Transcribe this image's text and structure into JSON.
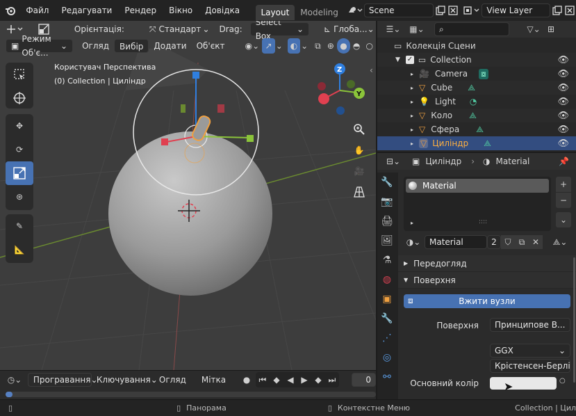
{
  "menu": {
    "items": [
      "Файл",
      "Редагувати",
      "Рендер",
      "Вікно",
      "Довідка"
    ],
    "tabs": [
      "Layout",
      "Modeling"
    ],
    "scene": "Scene",
    "view_layer": "View Layer"
  },
  "viewport_header": {
    "orientation_label": "Орієнтація:",
    "orientation_value": "Стандарт",
    "drag_label": "Drag:",
    "drag_value": "Select Box",
    "transform_value": "Глоба...",
    "mode": "Режим Об'є...",
    "view": "Огляд",
    "select": "Вибір",
    "add": "Додати",
    "object": "Об'єкт"
  },
  "viewport": {
    "view_name": "Користувач Перспектива",
    "collection_info": "(0) Collection | Циліндр",
    "gizmo_axes": [
      "X",
      "Y",
      "Z"
    ]
  },
  "timeline": {
    "playback": "Програвання",
    "keying": "Ключування",
    "view": "Огляд",
    "marker": "Мітка",
    "frame": "0"
  },
  "statusbar": {
    "pan": "Панорама",
    "context_menu": "Контекстне Меню",
    "info": "Collection | Цил"
  },
  "outliner": {
    "scene_collection": "Колекція Сцени",
    "collection": "Collection",
    "items": [
      {
        "name": "Camera",
        "kind": "camera",
        "selected": false
      },
      {
        "name": "Cube",
        "kind": "mesh",
        "selected": false
      },
      {
        "name": "Light",
        "kind": "light",
        "selected": false
      },
      {
        "name": "Коло",
        "kind": "mesh",
        "selected": false
      },
      {
        "name": "Сфера",
        "kind": "mesh",
        "selected": false
      },
      {
        "name": "Циліндр",
        "kind": "mesh",
        "selected": true
      }
    ]
  },
  "properties": {
    "breadcrumb_object": "Циліндр",
    "breadcrumb_material": "Material",
    "slot_name": "Material",
    "material_name": "Material",
    "users": "2",
    "preview_label": "Передогляд",
    "surface_label": "Поверхня",
    "use_nodes": "Вжити вузли",
    "surface_field_label": "Поверхня",
    "surface_value": "Принципове В...",
    "distribution": "GGX",
    "subsurface": "Крістенсен-Берлі",
    "base_color_label": "Основний колір",
    "base_color": "#e8e8e8"
  },
  "colors": {
    "accent": "#4772b3",
    "selection": "#334d80",
    "object_orange": "#f0a040",
    "axis_x": "#e04050",
    "axis_y": "#8bc43a",
    "axis_z": "#2f7fe0"
  }
}
